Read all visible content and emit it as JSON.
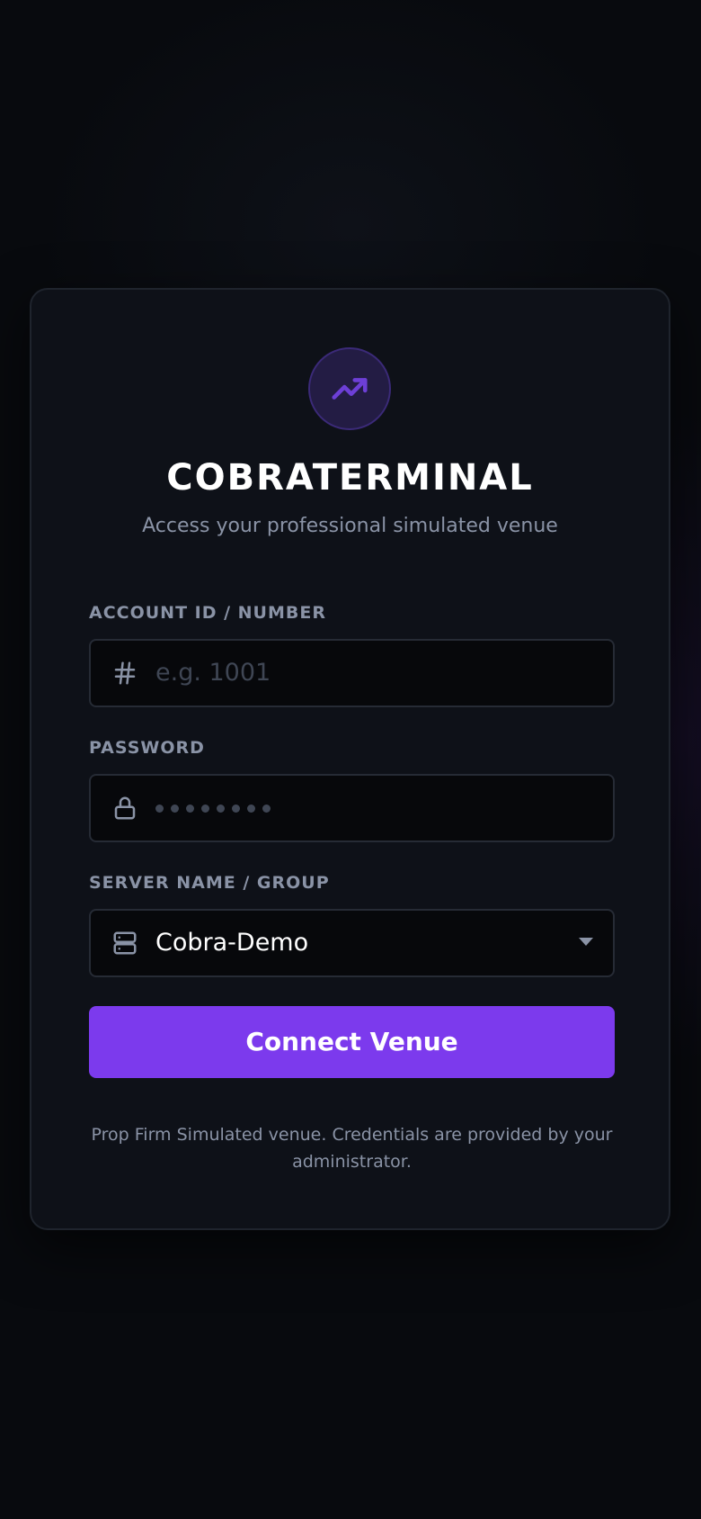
{
  "app": {
    "title": "COBRATERMINAL",
    "subtitle": "Access your professional simulated venue",
    "logo_icon": "trending-up-icon"
  },
  "form": {
    "account": {
      "label": "ACCOUNT ID / NUMBER",
      "placeholder": "e.g. 1001",
      "value": "",
      "icon": "hash-icon"
    },
    "password": {
      "label": "PASSWORD",
      "placeholder": "••••••••",
      "value": "",
      "icon": "lock-icon"
    },
    "server": {
      "label": "SERVER NAME / GROUP",
      "selected": "Cobra-Demo",
      "icon": "server-icon"
    },
    "submit_label": "Connect Venue"
  },
  "footer": {
    "note": "Prop Firm Simulated venue. Credentials are provided by your administrator."
  },
  "colors": {
    "accent": "#7c3aed",
    "background": "#080a0e",
    "card": "#0e1118",
    "muted_text": "#8a93a6"
  }
}
